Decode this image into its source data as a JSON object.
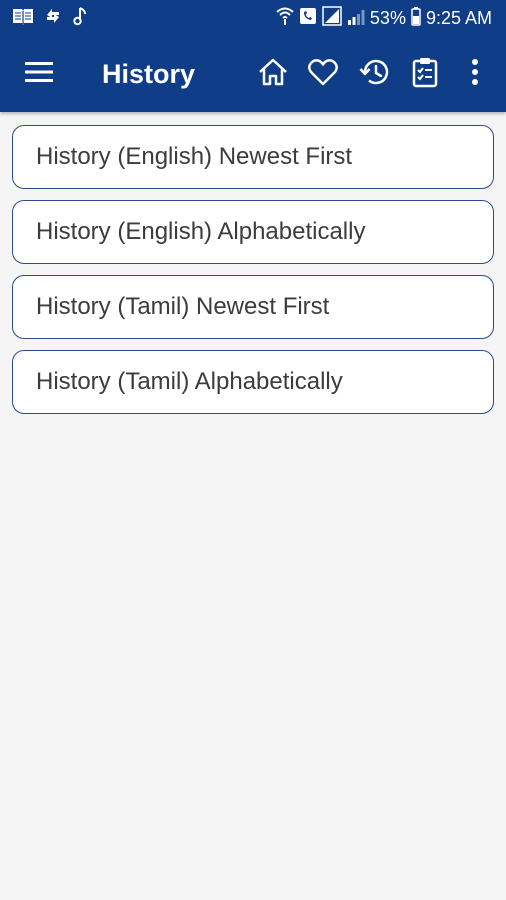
{
  "status_bar": {
    "battery": "53%",
    "time": "9:25 AM",
    "left_icons": [
      "book-icon",
      "sync-arrows-icon",
      "music-note-icon"
    ],
    "right_icons": [
      "wifi-call-icon",
      "phone-icon",
      "signal-icon",
      "signal-weak-icon",
      "battery-icon"
    ]
  },
  "app_bar": {
    "title": "History",
    "actions": [
      "home-icon",
      "heart-icon",
      "history-icon",
      "clipboard-icon",
      "more-vert-icon"
    ]
  },
  "history_options": [
    {
      "label": "History (English) Newest First"
    },
    {
      "label": "History (English) Alphabetically"
    },
    {
      "label": "History (Tamil) Newest First"
    },
    {
      "label": "History (Tamil) Alphabetically"
    }
  ],
  "colors": {
    "primary": "#0f3d87",
    "item_border": "#2b4a8b",
    "background": "#f5f5f5",
    "text": "#3c3c3c"
  }
}
